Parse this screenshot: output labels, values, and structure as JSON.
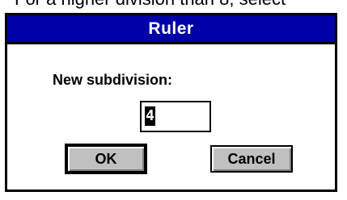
{
  "background_text": "For a higher division than 8, select",
  "dialog": {
    "title": "Ruler",
    "prompt": "New subdivision:",
    "field_value": "4",
    "buttons": {
      "ok": "OK",
      "cancel": "Cancel"
    }
  },
  "colors": {
    "titlebar": "#0000a8",
    "button_face": "#c0c0c0"
  }
}
